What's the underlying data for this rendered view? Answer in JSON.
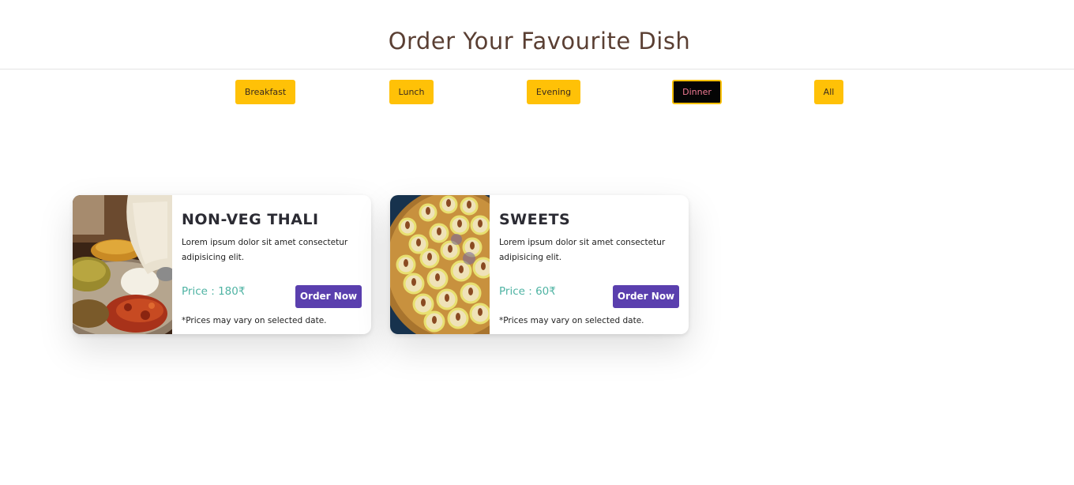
{
  "page": {
    "title": "Order Your Favourite Dish"
  },
  "filters": [
    {
      "label": "Breakfast",
      "active": false
    },
    {
      "label": "Lunch",
      "active": false
    },
    {
      "label": "Evening",
      "active": false
    },
    {
      "label": "Dinner",
      "active": true
    },
    {
      "label": "All",
      "active": false
    }
  ],
  "dishes": [
    {
      "name": "NON-VEG THALI",
      "description": "Lorem ipsum dolor sit amet consectetur adipisicing elit.",
      "price": "Price : 180₹",
      "order_label": "Order Now",
      "note": "*Prices may vary on selected date."
    },
    {
      "name": "SWEETS",
      "description": "Lorem ipsum dolor sit amet consectetur adipisicing elit.",
      "price": "Price : 60₹",
      "order_label": "Order Now",
      "note": "*Prices may vary on selected date."
    }
  ],
  "colors": {
    "title": "#5a3f33",
    "filter_button": "#ffc107",
    "filter_active_bg": "#050505",
    "filter_active_text": "#f07a94",
    "price_text": "#4fb3a3",
    "order_button": "#5a3fae"
  }
}
